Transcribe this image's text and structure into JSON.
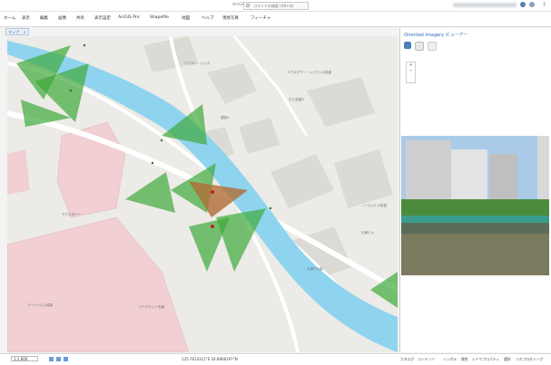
{
  "titlebar": {
    "app_title": "ArcGIS",
    "search_placeholder": "コマンドの検索 (Alt+Q)"
  },
  "ribbon": {
    "tabs": [
      "ホーム",
      "表示",
      "編集",
      "画像",
      "共有",
      "表示設定",
      "ArcGIS Pro",
      "Shapefile",
      "地図",
      "ヘルプ",
      "現地写真",
      "フィーチャ"
    ]
  },
  "map_tab": {
    "label": "マップ",
    "close": "×"
  },
  "map": {
    "labels": {
      "l1": "ウエスト・ヒルズ",
      "l2": "サウスタワー・レジデンス前橋",
      "l3": "中之島通り",
      "l4": "建物A",
      "l5": "サウスタワー",
      "l6": "ノースヒルズ前橋",
      "l7": "アーバンヒル前橋",
      "l8": "パークサイド壱番",
      "l9": "日東ビル",
      "l10": "大通り公園"
    }
  },
  "viewer": {
    "title": "Oriented Imagery ビューアー",
    "zoom_in": "+",
    "zoom_out": "−"
  },
  "statusbar": {
    "scale": "1:1,000",
    "coords": "135.7614311°E 34.6868197°N",
    "tabs": [
      "カタログ",
      "コンテンツ",
      "シンボル",
      "属性",
      "レイヤプロパティ",
      "選択",
      "ジオプロセシング"
    ]
  },
  "colors": {
    "river": "#8fd4ee",
    "coverage": "#3faa3b",
    "selected": "#b06d34",
    "building": "#f1cfd3"
  }
}
